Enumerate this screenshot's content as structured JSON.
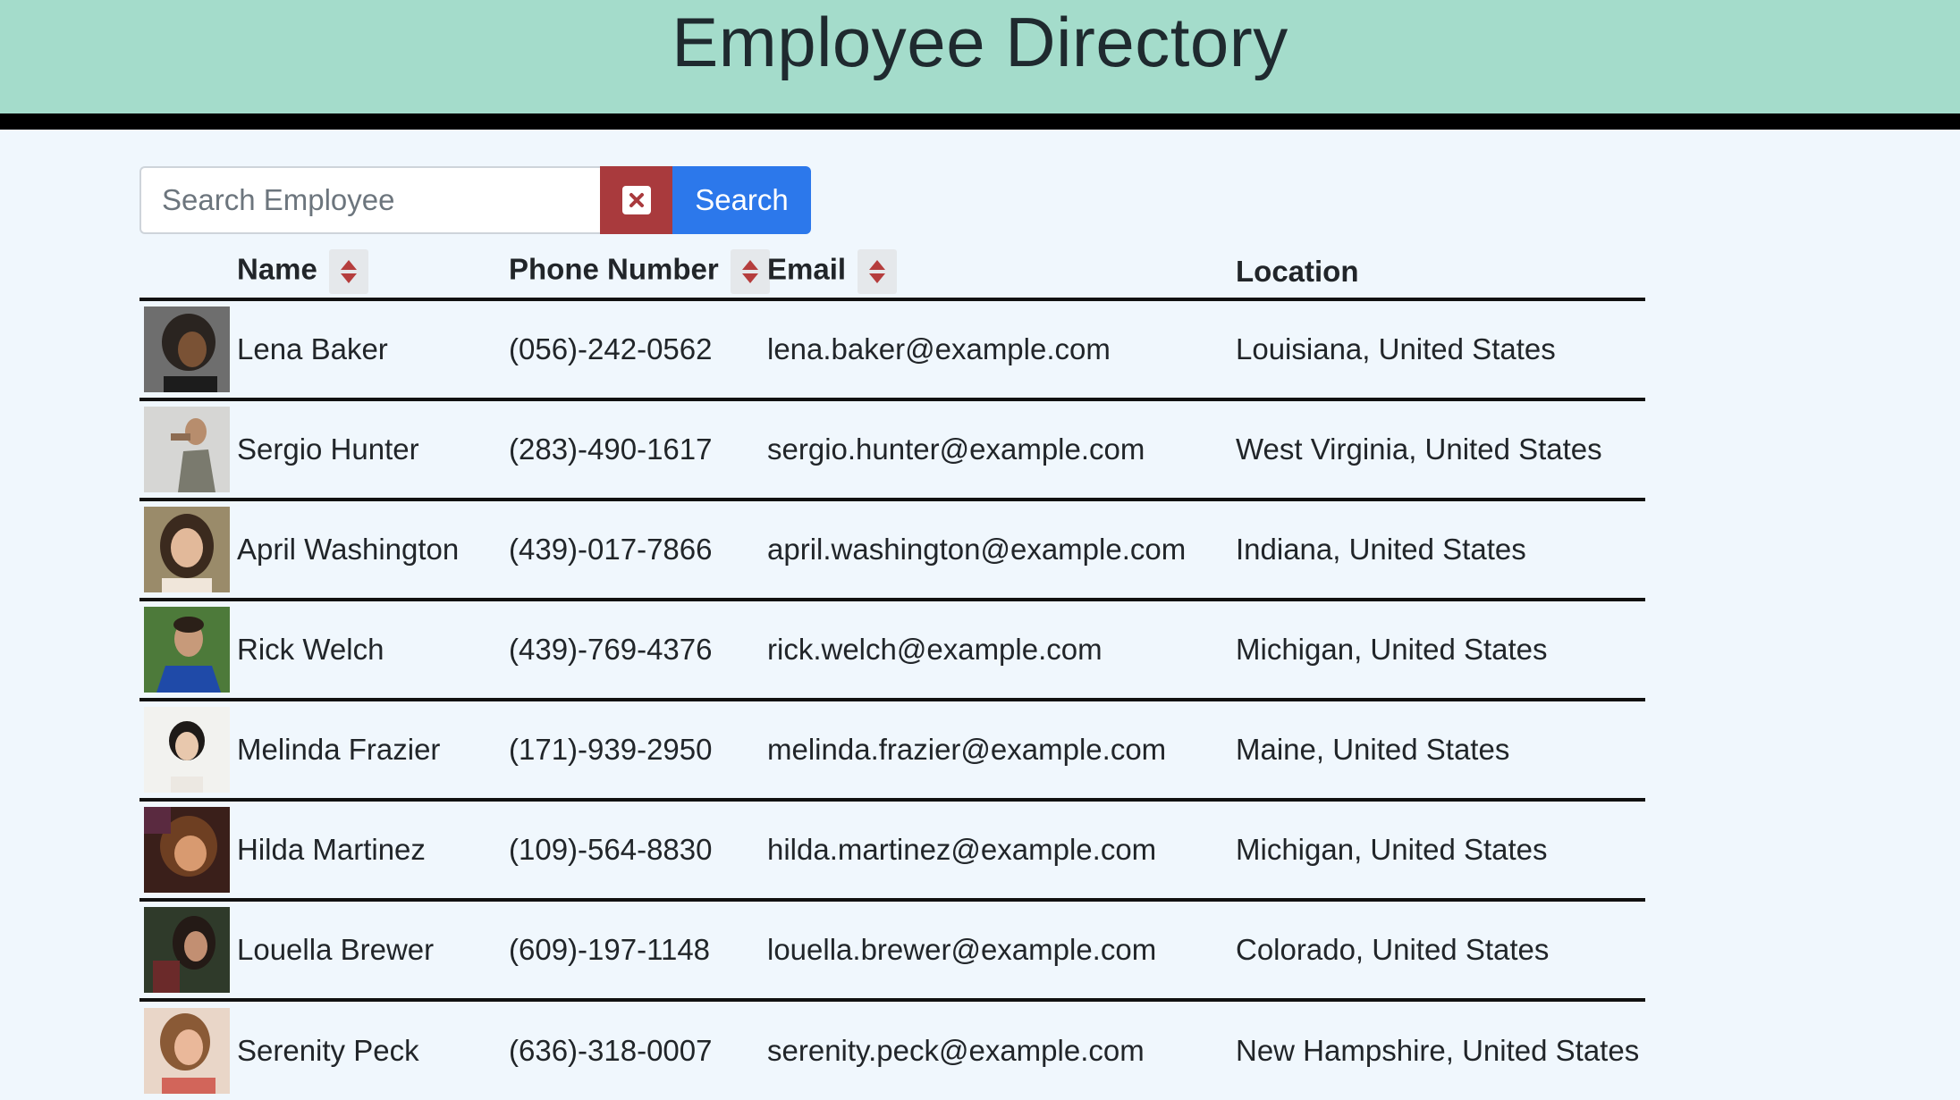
{
  "header": {
    "title": "Employee Directory"
  },
  "search": {
    "placeholder": "Search Employee",
    "value": "",
    "button_label": "Search"
  },
  "table": {
    "columns": {
      "name": "Name",
      "phone": "Phone Number",
      "email": "Email",
      "location": "Location"
    },
    "rows": [
      {
        "name": "Lena Baker",
        "phone": "(056)-242-0562",
        "email": "lena.baker@example.com",
        "location": "Louisiana, United States"
      },
      {
        "name": "Sergio Hunter",
        "phone": "(283)-490-1617",
        "email": "sergio.hunter@example.com",
        "location": "West Virginia, United States"
      },
      {
        "name": "April Washington",
        "phone": "(439)-017-7866",
        "email": "april.washington@example.com",
        "location": "Indiana, United States"
      },
      {
        "name": "Rick Welch",
        "phone": "(439)-769-4376",
        "email": "rick.welch@example.com",
        "location": "Michigan, United States"
      },
      {
        "name": "Melinda Frazier",
        "phone": "(171)-939-2950",
        "email": "melinda.frazier@example.com",
        "location": "Maine, United States"
      },
      {
        "name": "Hilda Martinez",
        "phone": "(109)-564-8830",
        "email": "hilda.martinez@example.com",
        "location": "Michigan, United States"
      },
      {
        "name": "Louella Brewer",
        "phone": "(609)-197-1148",
        "email": "louella.brewer@example.com",
        "location": "Colorado, United States"
      },
      {
        "name": "Serenity Peck",
        "phone": "(636)-318-0007",
        "email": "serenity.peck@example.com",
        "location": "New Hampshire, United States"
      }
    ]
  },
  "colors": {
    "header_bg": "#a4dccb",
    "page_bg": "#f0f7fd",
    "clear_button": "#a93a3d",
    "search_button": "#2c78eb",
    "sort_arrow": "#b53d3d"
  },
  "icons": {
    "clear": "close-box-icon",
    "sort": "sort-arrows-icon",
    "avatar": "avatar-photo"
  }
}
